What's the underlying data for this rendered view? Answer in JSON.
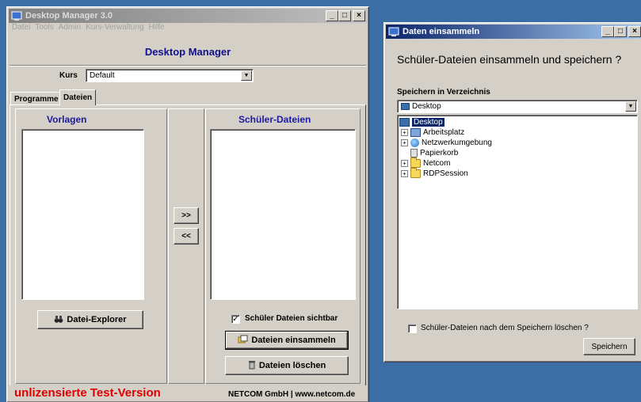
{
  "desktop_manager": {
    "title": "Desktop Manager 3.0",
    "menu": [
      "Datei",
      "Tools",
      "Admin",
      "Kurs-Verwaltung",
      "Hilfe"
    ],
    "header_title": "Desktop Manager",
    "kurs_label": "Kurs",
    "kurs_value": "Default",
    "tabs": [
      "Programme",
      "Dateien"
    ],
    "active_tab": "Dateien",
    "left_panel_title": "Vorlagen",
    "right_panel_title": "Schüler-Dateien",
    "move_right_label": ">>",
    "move_left_label": "<<",
    "datei_explorer_label": "Datei-Explorer",
    "sichtbar_label": "Schüler Dateien sichtbar",
    "sichtbar_checked": true,
    "einsammeln_label": "Dateien einsammeln",
    "loeschen_label": "Dateien löschen",
    "unlicensed_text": "unlizensierte Test-Version",
    "company_text": "NETCOM GmbH | www.netcom.de"
  },
  "daten_einsammeln": {
    "title": "Daten einsammeln",
    "question": "Schüler-Dateien einsammeln und speichern ?",
    "dir_label": "Speichern in Verzeichnis",
    "dir_value": "Desktop",
    "tree": [
      {
        "label": "Desktop",
        "level": 0,
        "expander": "",
        "icon": "desktop-icon",
        "selected": true
      },
      {
        "label": "Arbeitsplatz",
        "level": 1,
        "expander": "+",
        "icon": "computer-icon",
        "selected": false
      },
      {
        "label": "Netzwerkumgebung",
        "level": 1,
        "expander": "+",
        "icon": "network-icon",
        "selected": false
      },
      {
        "label": "Papierkorb",
        "level": 1,
        "expander": "",
        "icon": "recycle-bin-icon",
        "selected": false
      },
      {
        "label": "Netcom",
        "level": 1,
        "expander": "+",
        "icon": "folder-icon",
        "selected": false
      },
      {
        "label": "RDPSession",
        "level": 1,
        "expander": "+",
        "icon": "folder-icon",
        "selected": false
      }
    ],
    "delete_after_label": "Schüler-Dateien nach dem Speichern löschen ?",
    "delete_after_checked": false,
    "save_label": "Speichern"
  },
  "colors": {
    "accent_title": "#10108c",
    "warning_red": "#e00000",
    "active_titlebar": "#0a246a",
    "desktop_bg": "#3a6ea5"
  }
}
